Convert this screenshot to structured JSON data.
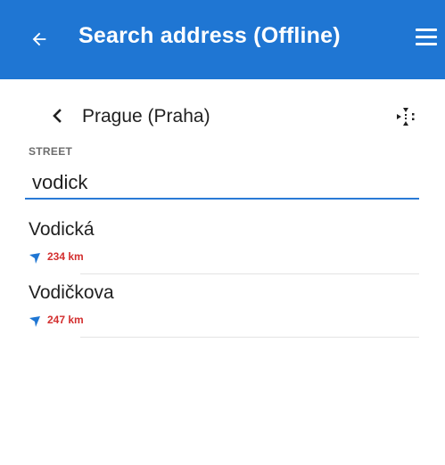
{
  "appbar": {
    "title": "Search address (Offline)",
    "back_icon": "arrow-left-icon",
    "menu_icon": "hamburger-menu-icon",
    "background": "#1f76d3"
  },
  "location": {
    "city": "Prague (Praha)",
    "back_icon": "chevron-left-icon",
    "gps_icon": "gps-crosshair-icon"
  },
  "street": {
    "label": "STREET",
    "value": "vodick",
    "accent": "#2a7ad6"
  },
  "results": [
    {
      "name": "Vodická",
      "distance": "234 km",
      "direction_icon": "direction-arrow-icon"
    },
    {
      "name": "Vodičkova",
      "distance": "247 km",
      "direction_icon": "direction-arrow-icon"
    }
  ],
  "colors": {
    "distance": "#d32f2f",
    "direction": "#1f76d3"
  }
}
